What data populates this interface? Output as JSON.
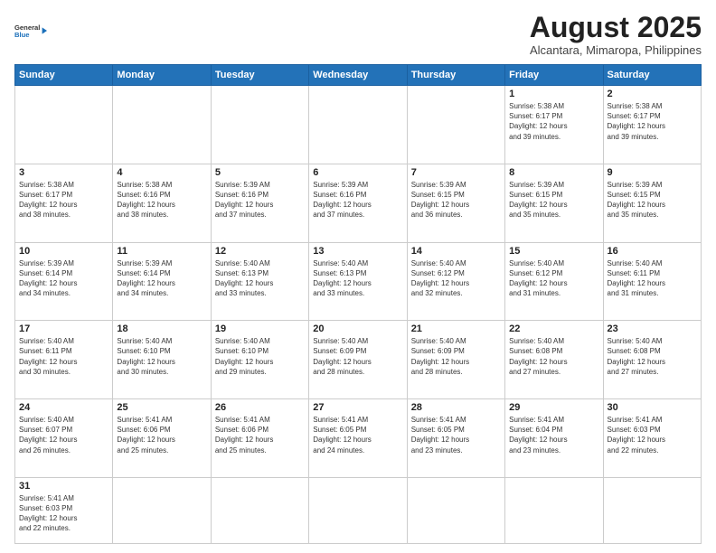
{
  "header": {
    "logo_general": "General",
    "logo_blue": "Blue",
    "month_title": "August 2025",
    "location": "Alcantara, Mimaropa, Philippines"
  },
  "days_of_week": [
    "Sunday",
    "Monday",
    "Tuesday",
    "Wednesday",
    "Thursday",
    "Friday",
    "Saturday"
  ],
  "weeks": [
    [
      {
        "day": "",
        "info": ""
      },
      {
        "day": "",
        "info": ""
      },
      {
        "day": "",
        "info": ""
      },
      {
        "day": "",
        "info": ""
      },
      {
        "day": "",
        "info": ""
      },
      {
        "day": "1",
        "info": "Sunrise: 5:38 AM\nSunset: 6:17 PM\nDaylight: 12 hours\nand 39 minutes."
      },
      {
        "day": "2",
        "info": "Sunrise: 5:38 AM\nSunset: 6:17 PM\nDaylight: 12 hours\nand 39 minutes."
      }
    ],
    [
      {
        "day": "3",
        "info": "Sunrise: 5:38 AM\nSunset: 6:17 PM\nDaylight: 12 hours\nand 38 minutes."
      },
      {
        "day": "4",
        "info": "Sunrise: 5:38 AM\nSunset: 6:16 PM\nDaylight: 12 hours\nand 38 minutes."
      },
      {
        "day": "5",
        "info": "Sunrise: 5:39 AM\nSunset: 6:16 PM\nDaylight: 12 hours\nand 37 minutes."
      },
      {
        "day": "6",
        "info": "Sunrise: 5:39 AM\nSunset: 6:16 PM\nDaylight: 12 hours\nand 37 minutes."
      },
      {
        "day": "7",
        "info": "Sunrise: 5:39 AM\nSunset: 6:15 PM\nDaylight: 12 hours\nand 36 minutes."
      },
      {
        "day": "8",
        "info": "Sunrise: 5:39 AM\nSunset: 6:15 PM\nDaylight: 12 hours\nand 35 minutes."
      },
      {
        "day": "9",
        "info": "Sunrise: 5:39 AM\nSunset: 6:15 PM\nDaylight: 12 hours\nand 35 minutes."
      }
    ],
    [
      {
        "day": "10",
        "info": "Sunrise: 5:39 AM\nSunset: 6:14 PM\nDaylight: 12 hours\nand 34 minutes."
      },
      {
        "day": "11",
        "info": "Sunrise: 5:39 AM\nSunset: 6:14 PM\nDaylight: 12 hours\nand 34 minutes."
      },
      {
        "day": "12",
        "info": "Sunrise: 5:40 AM\nSunset: 6:13 PM\nDaylight: 12 hours\nand 33 minutes."
      },
      {
        "day": "13",
        "info": "Sunrise: 5:40 AM\nSunset: 6:13 PM\nDaylight: 12 hours\nand 33 minutes."
      },
      {
        "day": "14",
        "info": "Sunrise: 5:40 AM\nSunset: 6:12 PM\nDaylight: 12 hours\nand 32 minutes."
      },
      {
        "day": "15",
        "info": "Sunrise: 5:40 AM\nSunset: 6:12 PM\nDaylight: 12 hours\nand 31 minutes."
      },
      {
        "day": "16",
        "info": "Sunrise: 5:40 AM\nSunset: 6:11 PM\nDaylight: 12 hours\nand 31 minutes."
      }
    ],
    [
      {
        "day": "17",
        "info": "Sunrise: 5:40 AM\nSunset: 6:11 PM\nDaylight: 12 hours\nand 30 minutes."
      },
      {
        "day": "18",
        "info": "Sunrise: 5:40 AM\nSunset: 6:10 PM\nDaylight: 12 hours\nand 30 minutes."
      },
      {
        "day": "19",
        "info": "Sunrise: 5:40 AM\nSunset: 6:10 PM\nDaylight: 12 hours\nand 29 minutes."
      },
      {
        "day": "20",
        "info": "Sunrise: 5:40 AM\nSunset: 6:09 PM\nDaylight: 12 hours\nand 28 minutes."
      },
      {
        "day": "21",
        "info": "Sunrise: 5:40 AM\nSunset: 6:09 PM\nDaylight: 12 hours\nand 28 minutes."
      },
      {
        "day": "22",
        "info": "Sunrise: 5:40 AM\nSunset: 6:08 PM\nDaylight: 12 hours\nand 27 minutes."
      },
      {
        "day": "23",
        "info": "Sunrise: 5:40 AM\nSunset: 6:08 PM\nDaylight: 12 hours\nand 27 minutes."
      }
    ],
    [
      {
        "day": "24",
        "info": "Sunrise: 5:40 AM\nSunset: 6:07 PM\nDaylight: 12 hours\nand 26 minutes."
      },
      {
        "day": "25",
        "info": "Sunrise: 5:41 AM\nSunset: 6:06 PM\nDaylight: 12 hours\nand 25 minutes."
      },
      {
        "day": "26",
        "info": "Sunrise: 5:41 AM\nSunset: 6:06 PM\nDaylight: 12 hours\nand 25 minutes."
      },
      {
        "day": "27",
        "info": "Sunrise: 5:41 AM\nSunset: 6:05 PM\nDaylight: 12 hours\nand 24 minutes."
      },
      {
        "day": "28",
        "info": "Sunrise: 5:41 AM\nSunset: 6:05 PM\nDaylight: 12 hours\nand 23 minutes."
      },
      {
        "day": "29",
        "info": "Sunrise: 5:41 AM\nSunset: 6:04 PM\nDaylight: 12 hours\nand 23 minutes."
      },
      {
        "day": "30",
        "info": "Sunrise: 5:41 AM\nSunset: 6:03 PM\nDaylight: 12 hours\nand 22 minutes."
      }
    ],
    [
      {
        "day": "31",
        "info": "Sunrise: 5:41 AM\nSunset: 6:03 PM\nDaylight: 12 hours\nand 22 minutes."
      },
      {
        "day": "",
        "info": ""
      },
      {
        "day": "",
        "info": ""
      },
      {
        "day": "",
        "info": ""
      },
      {
        "day": "",
        "info": ""
      },
      {
        "day": "",
        "info": ""
      },
      {
        "day": "",
        "info": ""
      }
    ]
  ]
}
